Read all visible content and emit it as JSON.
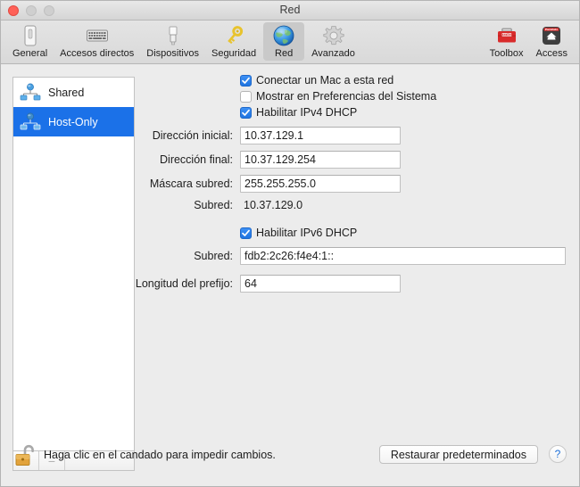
{
  "window": {
    "title": "Red",
    "traffic_lights": [
      "close",
      "minimize",
      "maximize"
    ]
  },
  "toolbar": {
    "items": [
      {
        "label": "General",
        "icon": "general-icon",
        "selected": false
      },
      {
        "label": "Accesos directos",
        "icon": "keyboard-icon",
        "selected": false
      },
      {
        "label": "Dispositivos",
        "icon": "usb-device-icon",
        "selected": false
      },
      {
        "label": "Seguridad",
        "icon": "key-icon",
        "selected": false
      },
      {
        "label": "Red",
        "icon": "globe-icon",
        "selected": true
      },
      {
        "label": "Avanzado",
        "icon": "gear-icon",
        "selected": false
      }
    ],
    "right_items": [
      {
        "label": "Toolbox",
        "icon": "toolbox-icon"
      },
      {
        "label": "Access",
        "icon": "access-icon"
      }
    ]
  },
  "sidebar": {
    "items": [
      {
        "label": "Shared",
        "icon": "network-icon",
        "selected": false
      },
      {
        "label": "Host-Only",
        "icon": "network-icon",
        "selected": true
      }
    ],
    "add_label": "+",
    "remove_label": "−"
  },
  "pane": {
    "checkbox_connect": {
      "label": "Conectar un Mac a esta red",
      "checked": true
    },
    "checkbox_show_prefs": {
      "label": "Mostrar en Preferencias del Sistema",
      "checked": false
    },
    "checkbox_ipv4": {
      "label": "Habilitar IPv4 DHCP",
      "checked": true
    },
    "start_address": {
      "label": "Dirección inicial:",
      "value": "10.37.129.1"
    },
    "end_address": {
      "label": "Dirección final:",
      "value": "10.37.129.254"
    },
    "subnet_mask": {
      "label": "Máscara subred:",
      "value": "255.255.255.0"
    },
    "subnet_v4": {
      "label": "Subred:",
      "value": "10.37.129.0"
    },
    "checkbox_ipv6": {
      "label": "Habilitar IPv6 DHCP",
      "checked": true
    },
    "subnet_v6": {
      "label": "Subred:",
      "value": "fdb2:2c26:f4e4:1::"
    },
    "prefix_length": {
      "label": "Longitud del prefijo:",
      "value": "64"
    }
  },
  "bottom": {
    "lock_icon": "unlocked-padlock-icon",
    "lock_text": "Haga clic en el candado para impedir cambios.",
    "restore_label": "Restaurar predeterminados",
    "help_label": "?"
  },
  "colors": {
    "accent_blue": "#1b71e8",
    "window_bg": "#ececec",
    "sidebar_bg": "#ffffff",
    "toolbar_bg": "#dedede"
  }
}
